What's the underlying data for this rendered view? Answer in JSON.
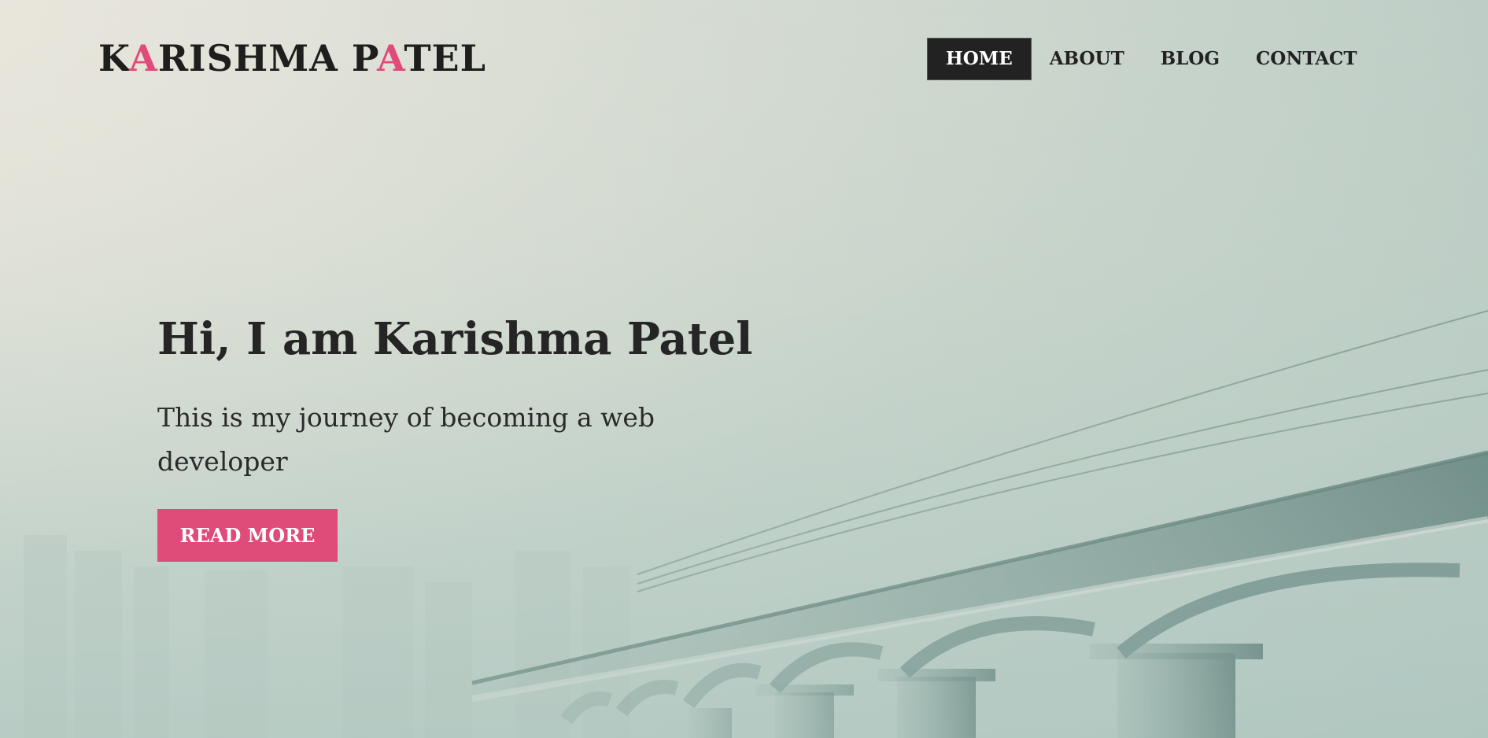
{
  "site": {
    "logo_parts": [
      "K",
      "A",
      "RISHMA P",
      "A",
      "TEL"
    ],
    "accent_color": "#e04c7a"
  },
  "nav": {
    "items": [
      {
        "label": "HOME",
        "active": true
      },
      {
        "label": "ABOUT",
        "active": false
      },
      {
        "label": "BLOG",
        "active": false
      },
      {
        "label": "CONTACT",
        "active": false
      }
    ]
  },
  "hero": {
    "title": "Hi, I am Karishma Patel",
    "subtitle": "This is my journey of becoming a web developer",
    "button_label": "READ MORE",
    "background_image": "foggy-railway-bridge"
  }
}
